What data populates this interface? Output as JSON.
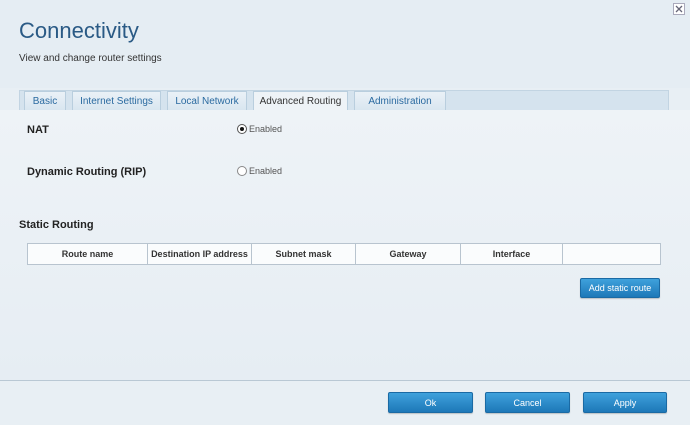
{
  "header": {
    "title": "Connectivity",
    "subtitle": "View and change router settings"
  },
  "tabs": [
    {
      "label": "Basic",
      "active": false
    },
    {
      "label": "Internet Settings",
      "active": false
    },
    {
      "label": "Local Network",
      "active": false
    },
    {
      "label": "Advanced Routing",
      "active": true
    },
    {
      "label": "Administration",
      "active": false
    }
  ],
  "nat": {
    "label": "NAT",
    "option_label": "Enabled",
    "checked": true
  },
  "rip": {
    "label": "Dynamic Routing (RIP)",
    "option_label": "Enabled",
    "checked": false
  },
  "static_routing": {
    "title": "Static Routing",
    "columns": [
      "Route name",
      "Destination IP address",
      "Subnet mask",
      "Gateway",
      "Interface",
      ""
    ],
    "add_button": "Add static route"
  },
  "footer": {
    "ok_label": "Ok",
    "cancel_label": "Cancel",
    "apply_label": "Apply"
  },
  "colors": {
    "accent": "#2a6aa0",
    "button": "#2588c8"
  }
}
